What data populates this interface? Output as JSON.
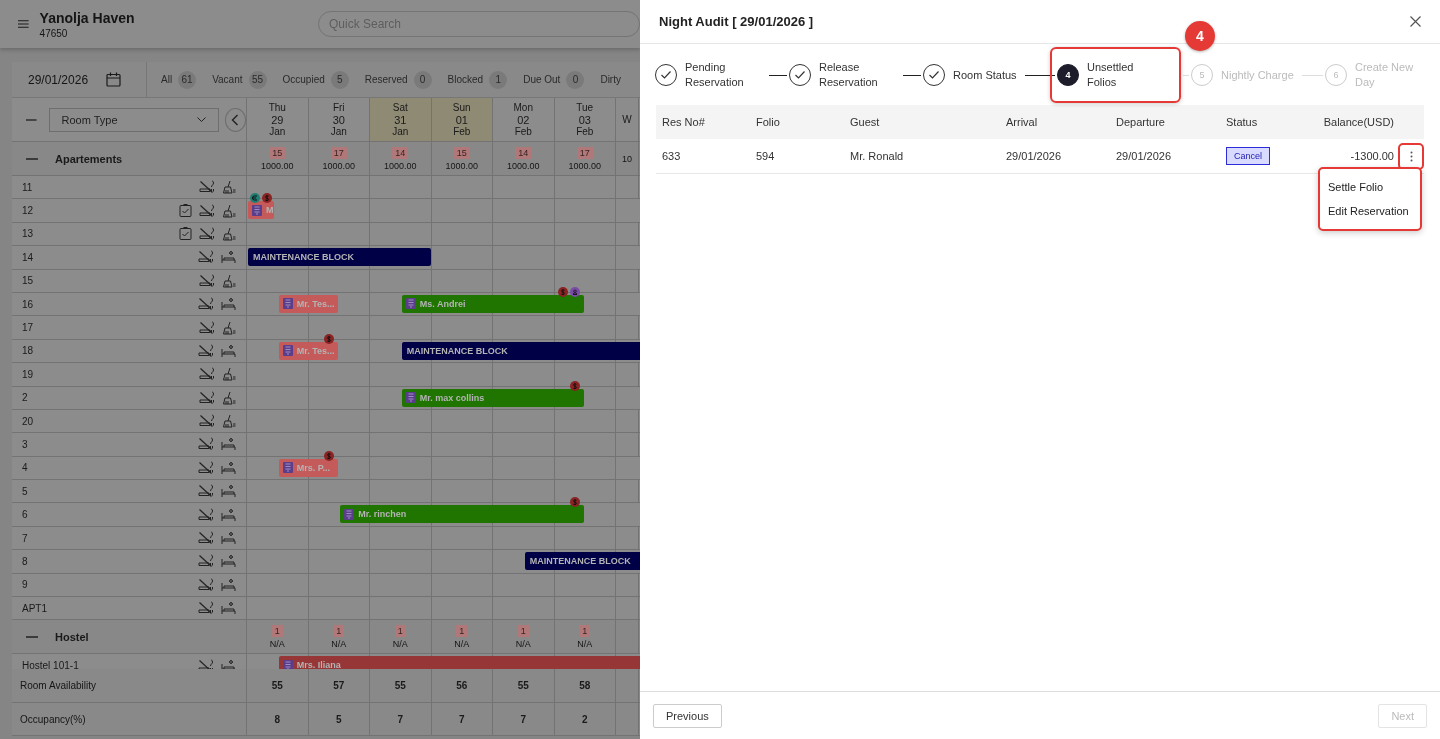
{
  "header": {
    "title": "Yanolja Haven",
    "code": "47650",
    "search": {
      "placeholder": "Quick Search"
    }
  },
  "filter": {
    "date": "29/01/2026",
    "counts": [
      {
        "label": "All",
        "count": "61"
      },
      {
        "label": "Vacant",
        "count": "55"
      },
      {
        "label": "Occupied",
        "count": "5"
      },
      {
        "label": "Reserved",
        "count": "0"
      },
      {
        "label": "Blocked",
        "count": "1"
      },
      {
        "label": "Due Out",
        "count": "0"
      },
      {
        "label": "Dirty"
      }
    ]
  },
  "grid": {
    "room_type": "Room Type",
    "days": [
      {
        "dow": "Thu",
        "day": "29",
        "month": "Jan",
        "weekend": false
      },
      {
        "dow": "Fri",
        "day": "30",
        "month": "Jan",
        "weekend": false
      },
      {
        "dow": "Sat",
        "day": "31",
        "month": "Jan",
        "weekend": true
      },
      {
        "dow": "Sun",
        "day": "01",
        "month": "Feb",
        "weekend": true
      },
      {
        "dow": "Mon",
        "day": "02",
        "month": "Feb",
        "weekend": false
      },
      {
        "dow": "Tue",
        "day": "03",
        "month": "Feb",
        "weekend": false
      },
      {
        "dow": "W",
        "weekend": false
      }
    ],
    "groups": [
      {
        "name": "Apartements",
        "cells": [
          {
            "count": "15",
            "rate": "1000.00"
          },
          {
            "count": "17",
            "rate": "1000.00"
          },
          {
            "count": "14",
            "rate": "1000.00"
          },
          {
            "count": "15",
            "rate": "1000.00"
          },
          {
            "count": "14",
            "rate": "1000.00"
          },
          {
            "count": "17",
            "rate": "1000.00"
          },
          {
            "rate": "10"
          }
        ],
        "rooms": [
          {
            "name": "11",
            "inspected": false,
            "dirty": true
          },
          {
            "name": "12",
            "inspected": true,
            "dirty": true,
            "bookings": [
              {
                "kind": "reservation",
                "name": "M",
                "color": "#c45a5a",
                "linked": true,
                "payment": true,
                "guest": false
              }
            ]
          },
          {
            "name": "13",
            "inspected": true,
            "dirty": true
          },
          {
            "name": "14",
            "inspected": false,
            "dirty": false,
            "bookings": [
              {
                "kind": "block",
                "name": "MAINTENANCE BLOCK",
                "color": "#000046"
              }
            ]
          },
          {
            "name": "15",
            "inspected": false,
            "dirty": true
          },
          {
            "name": "16",
            "inspected": false,
            "dirty": false,
            "bookings": [
              {
                "kind": "reservation",
                "name": "Mr. Tes...",
                "color": "#c45a5a",
                "linked": false,
                "payment": false,
                "guest": false
              },
              {
                "kind": "reservation",
                "name": "Ms. Andrei",
                "color": "#1f7500",
                "linked": false,
                "payment": true,
                "guest": true
              }
            ]
          },
          {
            "name": "17",
            "inspected": false,
            "dirty": true
          },
          {
            "name": "18",
            "inspected": false,
            "dirty": false,
            "bookings": [
              {
                "kind": "reservation",
                "name": "Mr. Tes...",
                "color": "#c45a5a",
                "linked": false,
                "payment": true,
                "guest": false
              },
              {
                "kind": "block",
                "name": "MAINTENANCE BLOCK",
                "color": "#000046"
              }
            ]
          },
          {
            "name": "19",
            "inspected": false,
            "dirty": true
          },
          {
            "name": "2",
            "inspected": false,
            "dirty": true,
            "bookings": [
              {
                "kind": "reservation",
                "name": "Mr. max collins",
                "color": "#1f7500",
                "linked": false,
                "payment": true,
                "guest": false
              }
            ]
          },
          {
            "name": "20",
            "inspected": false,
            "dirty": true
          },
          {
            "name": "3",
            "inspected": false,
            "dirty": false
          },
          {
            "name": "4",
            "inspected": false,
            "dirty": false,
            "bookings": [
              {
                "kind": "reservation",
                "name": "Mrs. P...",
                "color": "#c45a5a",
                "linked": false,
                "payment": true,
                "guest": false
              }
            ]
          },
          {
            "name": "5",
            "inspected": false,
            "dirty": false
          },
          {
            "name": "6",
            "inspected": false,
            "dirty": false,
            "bookings": [
              {
                "kind": "reservation",
                "name": "Mr. rinchen",
                "color": "#1f7500",
                "linked": false,
                "payment": true,
                "guest": false
              }
            ]
          },
          {
            "name": "7",
            "inspected": false,
            "dirty": false
          },
          {
            "name": "8",
            "inspected": false,
            "dirty": false,
            "bookings": [
              {
                "kind": "block",
                "name": "MAINTENANCE BLOCK",
                "color": "#000046"
              }
            ]
          },
          {
            "name": "9",
            "inspected": false,
            "dirty": false
          },
          {
            "name": "APT1",
            "inspected": false,
            "dirty": false
          }
        ]
      },
      {
        "name": "Hostel",
        "cells": [
          {
            "count": "1",
            "rate": "N/A"
          },
          {
            "count": "1",
            "rate": "N/A"
          },
          {
            "count": "1",
            "rate": "N/A"
          },
          {
            "count": "1",
            "rate": "N/A"
          },
          {
            "count": "1",
            "rate": "N/A"
          },
          {
            "count": "1",
            "rate": "N/A"
          }
        ],
        "rooms": [
          {
            "name": "Hostel 101-1",
            "inspected": false,
            "dirty": false,
            "bookings": [
              {
                "kind": "reservation",
                "name": "Mrs. Iliana",
                "color": "#963636",
                "linked": false,
                "payment": false,
                "guest": false
              }
            ]
          }
        ]
      }
    ],
    "footer_rows": [
      {
        "label": "Room Availability",
        "values": [
          "55",
          "57",
          "55",
          "56",
          "55",
          "58"
        ]
      },
      {
        "label": "Occupancy(%)",
        "values": [
          "8",
          "5",
          "7",
          "7",
          "7",
          "2"
        ]
      }
    ]
  },
  "drawer": {
    "title": "Night Audit [ 29/01/2026 ]",
    "callout": "4",
    "steps": [
      {
        "label": "Pending Reservation",
        "completed": true,
        "current": false,
        "highlighted": false
      },
      {
        "label": "Release Reservation",
        "completed": true,
        "current": false,
        "highlighted": false
      },
      {
        "label": "Room Status",
        "completed": true,
        "current": false,
        "highlighted": false
      },
      {
        "number": "4",
        "label": "Unsettled Folios",
        "completed": false,
        "current": true,
        "highlighted": true
      },
      {
        "number": "5",
        "label": "Nightly Charge",
        "completed": false,
        "current": false,
        "highlighted": false
      },
      {
        "number": "6",
        "label": "Create New Day",
        "completed": false,
        "current": false,
        "highlighted": false
      }
    ],
    "table": {
      "columns": [
        "Res No#",
        "Folio",
        "Guest",
        "Arrival",
        "Departure",
        "Status",
        "Balance(USD)"
      ],
      "rows": [
        {
          "res_no": "633",
          "folio": "594",
          "guest": "Mr. Ronald",
          "arrival": "29/01/2026",
          "departure": "29/01/2026",
          "status": "Cancel",
          "balance": "-1300.00",
          "menu_button_highlighted": true,
          "menu": {
            "open": true,
            "highlighted": true,
            "items": [
              "Settle Folio",
              "Edit Reservation"
            ]
          }
        }
      ]
    },
    "buttons": [
      {
        "label": "Previous",
        "disabled": false
      },
      {
        "label": "Next",
        "disabled": true
      }
    ]
  }
}
